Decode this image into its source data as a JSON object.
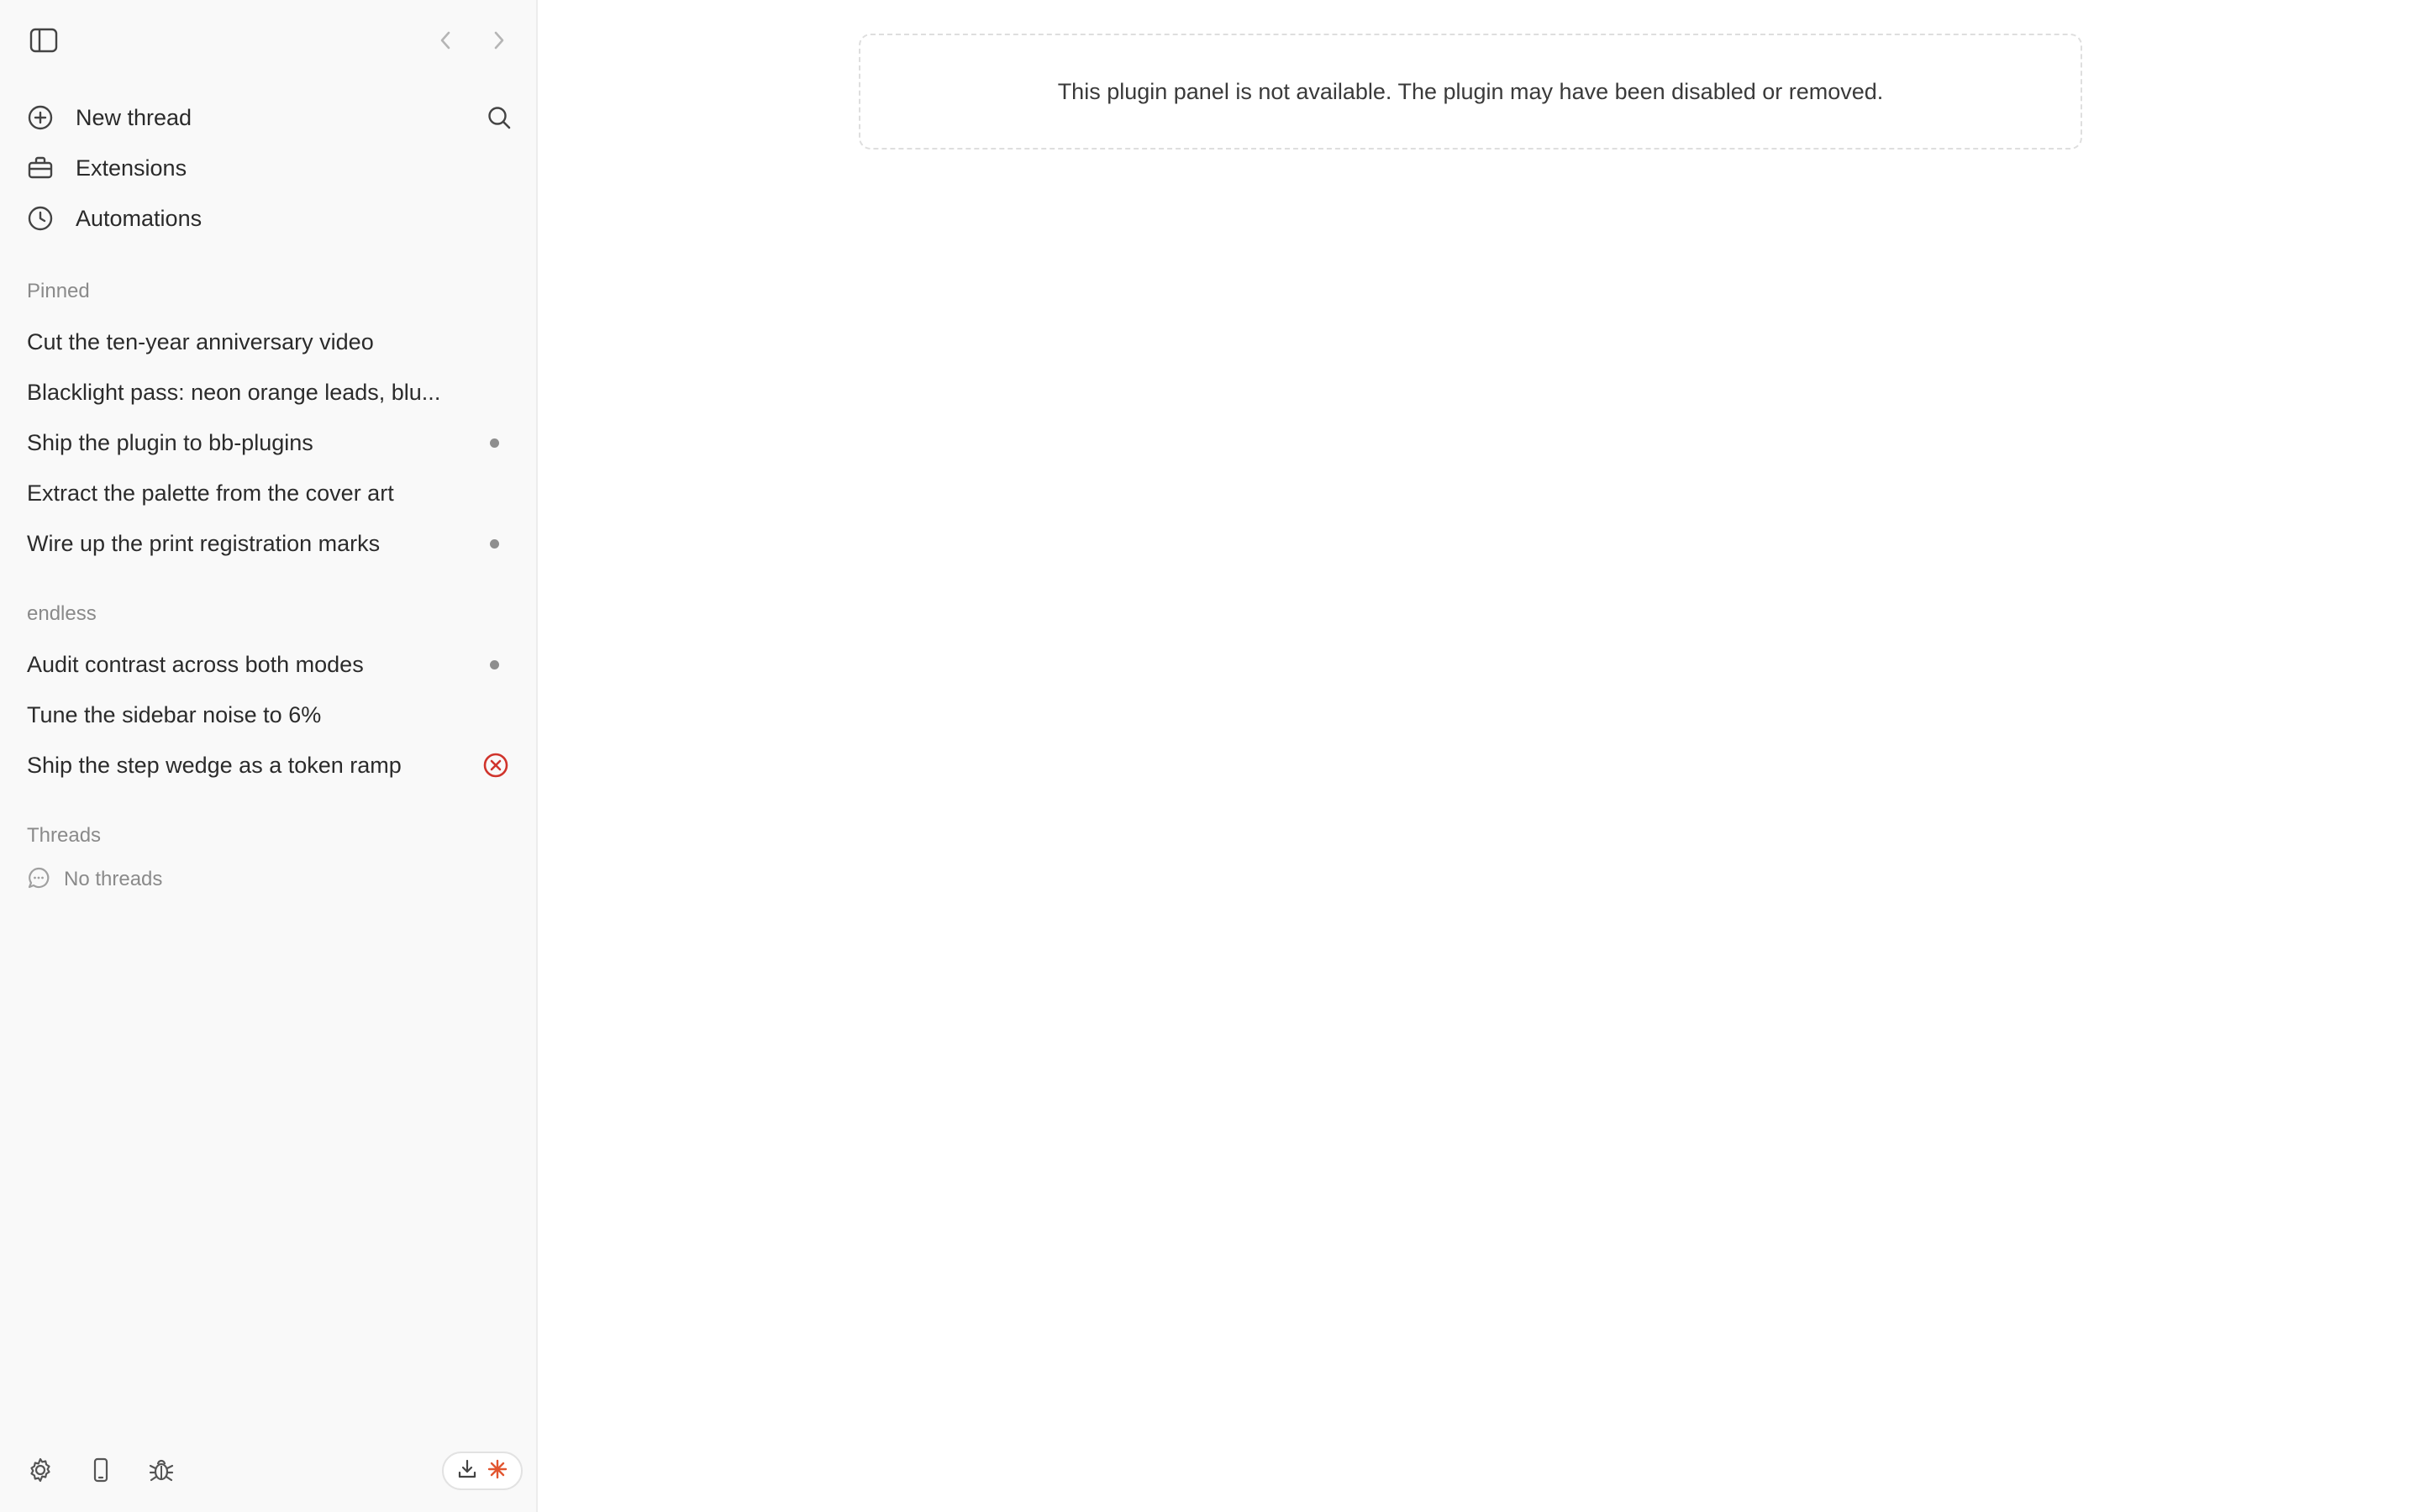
{
  "sidebar": {
    "nav": [
      {
        "label": "New thread",
        "icon": "plus-circle-icon"
      },
      {
        "label": "Extensions",
        "icon": "toolbox-icon"
      },
      {
        "label": "Automations",
        "icon": "clock-icon"
      }
    ],
    "pinned": {
      "title": "Pinned",
      "items": [
        {
          "title": "Cut the ten-year anniversary video",
          "status": "none"
        },
        {
          "title": "Blacklight pass: neon orange leads, blu...",
          "status": "none"
        },
        {
          "title": "Ship the plugin to bb-plugins",
          "status": "dot"
        },
        {
          "title": "Extract the palette from the cover art",
          "status": "none"
        },
        {
          "title": "Wire up the print registration marks",
          "status": "dot"
        }
      ]
    },
    "group": {
      "title": "endless",
      "items": [
        {
          "title": "Audit contrast across both modes",
          "status": "dot"
        },
        {
          "title": "Tune the sidebar noise to 6%",
          "status": "none"
        },
        {
          "title": "Ship the step wedge as a token ramp",
          "status": "error"
        }
      ]
    },
    "threads": {
      "title": "Threads",
      "empty_label": "No threads"
    },
    "footer_icons": [
      "settings-icon",
      "phone-icon",
      "bug-icon"
    ],
    "status_icons": [
      "download-icon",
      "spark-icon"
    ]
  },
  "main": {
    "notice": "This plugin panel is not available. The plugin may have been disabled or removed."
  },
  "colors": {
    "sidebar_bg": "#f9f9f9",
    "error": "#d0342c",
    "spark": "#e2552f",
    "dot": "#8e8e8e"
  }
}
